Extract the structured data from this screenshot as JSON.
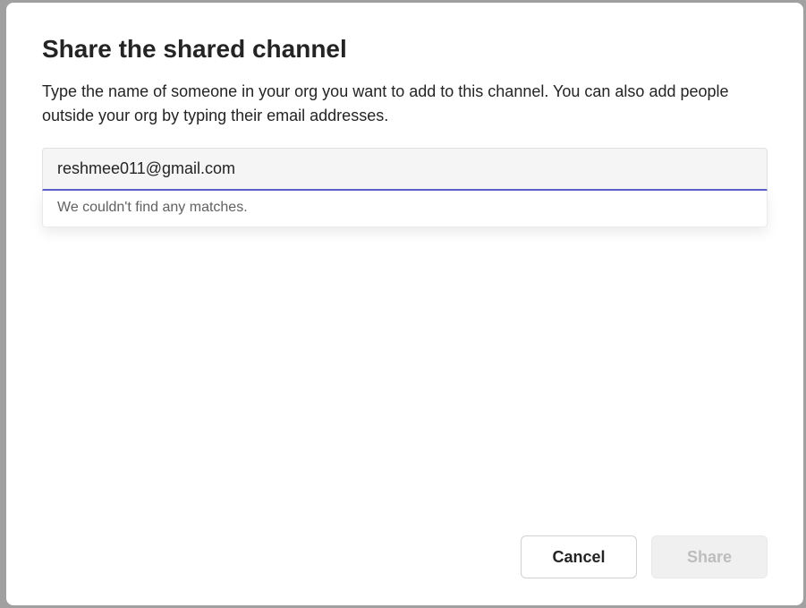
{
  "dialog": {
    "title": "Share the shared channel",
    "description": "Type the name of someone in your org you want to add to this channel. You can also add people outside your org by typing their email addresses.",
    "search": {
      "value": "reshmee011@gmail.com",
      "no_match_message": "We couldn't find any matches."
    },
    "buttons": {
      "cancel": "Cancel",
      "share": "Share"
    }
  }
}
